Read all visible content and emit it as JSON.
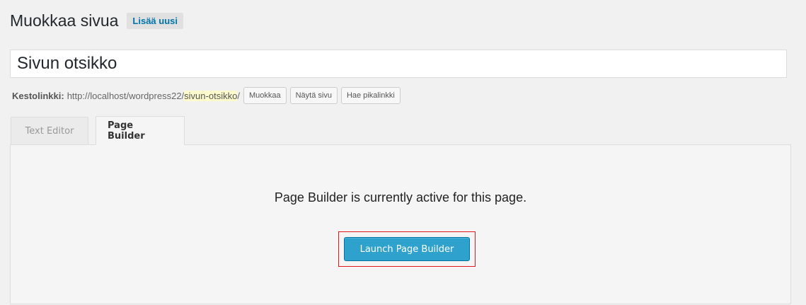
{
  "header": {
    "title": "Muokkaa sivua",
    "add_new_label": "Lisää uusi"
  },
  "title_field": {
    "value": "Sivun otsikko"
  },
  "permalink": {
    "label": "Kestolinkki:",
    "base_url": "http://localhost/wordpress22/",
    "slug": "sivun-otsikko",
    "trailing": "/",
    "edit_label": "Muokkaa",
    "view_label": "Näytä sivu",
    "shortlink_label": "Hae pikalinkki"
  },
  "tabs": [
    {
      "label": "Text Editor",
      "active": false
    },
    {
      "label": "Page Builder",
      "active": true
    }
  ],
  "panel": {
    "message": "Page Builder is currently active for this page.",
    "launch_label": "Launch Page Builder"
  },
  "colors": {
    "accent": "#2ea2cc",
    "highlight_border": "#e0191f",
    "link": "#0073aa"
  }
}
